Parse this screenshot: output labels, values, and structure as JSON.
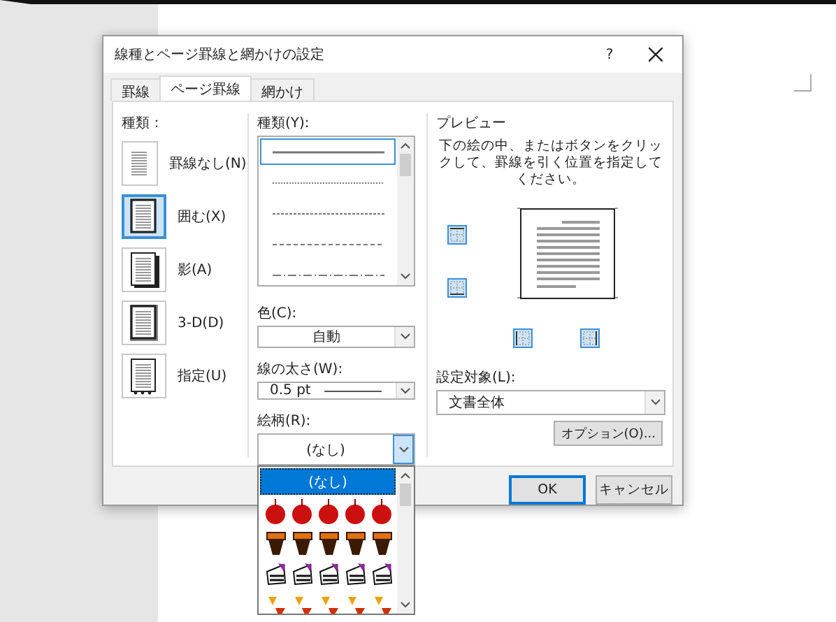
{
  "dialog": {
    "title": "線種とページ罫線と網かけの設定",
    "help": "?"
  },
  "tabs": [
    {
      "label": "罫線",
      "selected": false
    },
    {
      "label": "ページ罫線",
      "selected": true
    },
    {
      "label": "網かけ",
      "selected": false
    }
  ],
  "setting": {
    "label": "種類：",
    "items": [
      {
        "label": "罫線なし(N)",
        "kind": "none",
        "selected": false
      },
      {
        "label": "囲む(X)",
        "kind": "box",
        "selected": true
      },
      {
        "label": "影(A)",
        "kind": "shadow",
        "selected": false
      },
      {
        "label": "3-D(D)",
        "kind": "threed",
        "selected": false
      },
      {
        "label": "指定(U)",
        "kind": "custom",
        "selected": false
      }
    ]
  },
  "style": {
    "label": "種類(Y):",
    "lines": [
      {
        "kind": "solid",
        "selected": true
      },
      {
        "kind": "dotted",
        "selected": false
      },
      {
        "kind": "dashed-short",
        "selected": false
      },
      {
        "kind": "dashed",
        "selected": false
      },
      {
        "kind": "dash-dot",
        "selected": false
      }
    ]
  },
  "color": {
    "label": "色(C):",
    "value": "自動"
  },
  "width": {
    "label": "線の太さ(W):",
    "value": "0.5 pt"
  },
  "art": {
    "label": "絵柄(R):",
    "value": "(なし)",
    "expanded": true,
    "options": [
      {
        "kind": "text",
        "label": "(なし)",
        "selected": true
      },
      {
        "kind": "apples",
        "selected": false
      },
      {
        "kind": "cakes",
        "selected": false
      },
      {
        "kind": "slices",
        "selected": false
      },
      {
        "kind": "candy",
        "selected": false
      }
    ]
  },
  "preview": {
    "title": "プレビュー",
    "instructions": "下の絵の中、またはボタンをクリックして、罫線を引く位置を指定してください。",
    "border_buttons": [
      {
        "kind": "top",
        "on": true
      },
      {
        "kind": "bottom",
        "on": true
      },
      {
        "kind": "left",
        "on": true
      },
      {
        "kind": "right",
        "on": true
      }
    ]
  },
  "apply_to": {
    "label": "設定対象(L):",
    "value": "文書全体"
  },
  "options_button": "オプション(O)...",
  "buttons": [
    {
      "label": "OK",
      "kind": "default"
    },
    {
      "label": "キャンセル",
      "kind": "normal"
    }
  ]
}
